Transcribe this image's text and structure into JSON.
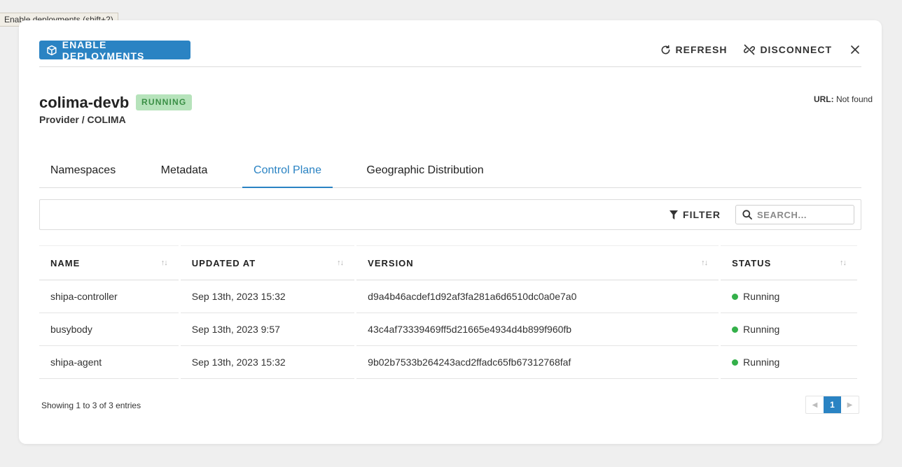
{
  "tooltip": "Enable deployments (shift+2)",
  "header": {
    "enable_label": "ENABLE DEPLOYMENTS",
    "refresh_label": "REFRESH",
    "disconnect_label": "DISCONNECT"
  },
  "cluster": {
    "name": "colima-devb",
    "status": "RUNNING",
    "provider": "Provider / COLIMA",
    "url_label": "URL:",
    "url_value": "Not found"
  },
  "tabs": [
    {
      "label": "Namespaces"
    },
    {
      "label": "Metadata"
    },
    {
      "label": "Control Plane",
      "active": true
    },
    {
      "label": "Geographic Distribution"
    }
  ],
  "toolbar": {
    "filter_label": "FILTER",
    "search_placeholder": "SEARCH..."
  },
  "table": {
    "columns": [
      "NAME",
      "UPDATED AT",
      "VERSION",
      "STATUS"
    ],
    "rows": [
      {
        "name": "shipa-controller",
        "updated": "Sep 13th, 2023 15:32",
        "version": "d9a4b46acdef1d92af3fa281a6d6510dc0a0e7a0",
        "status": "Running"
      },
      {
        "name": "busybody",
        "updated": "Sep 13th, 2023 9:57",
        "version": "43c4af73339469ff5d21665e4934d4b899f960fb",
        "status": "Running"
      },
      {
        "name": "shipa-agent",
        "updated": "Sep 13th, 2023 15:32",
        "version": "9b02b7533b264243acd2ffadc65fb67312768faf",
        "status": "Running"
      }
    ]
  },
  "footer": {
    "showing": "Showing 1 to 3 of 3 entries",
    "current_page": "1"
  },
  "colors": {
    "accent": "#2a83c3",
    "running_green": "#34b04a",
    "badge_bg": "#b6e3bb"
  }
}
